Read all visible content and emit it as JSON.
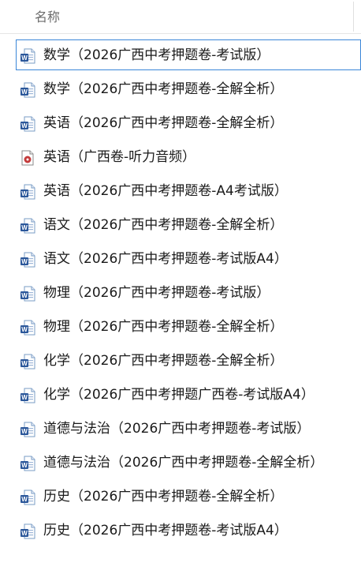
{
  "column_header": {
    "name_label": "名称"
  },
  "colors": {
    "selection_border": "#3a86d8",
    "word_icon_blue": "#2b579a",
    "audio_icon_red": "#c43b3b"
  },
  "files": [
    {
      "name": "数学（2026广西中考押题卷-考试版）",
      "icon": "word-document-icon",
      "selected": true
    },
    {
      "name": "数学（2026广西中考押题卷-全解全析）",
      "icon": "word-document-icon",
      "selected": false
    },
    {
      "name": "英语（2026广西中考押题卷-全解全析）",
      "icon": "word-document-icon",
      "selected": false
    },
    {
      "name": "英语（广西卷-听力音频）",
      "icon": "audio-file-icon",
      "selected": false
    },
    {
      "name": "英语（2026广西中考押题卷-A4考试版）",
      "icon": "word-document-icon",
      "selected": false
    },
    {
      "name": "语文（2026广西中考押题卷-全解全析）",
      "icon": "word-document-icon",
      "selected": false
    },
    {
      "name": "语文（2026广西中考押题卷-考试版A4）",
      "icon": "word-document-icon",
      "selected": false
    },
    {
      "name": "物理（2026广西中考押题卷-考试版）",
      "icon": "word-document-icon",
      "selected": false
    },
    {
      "name": "物理（2026广西中考押题卷-全解全析）",
      "icon": "word-document-icon",
      "selected": false
    },
    {
      "name": "化学（2026广西中考押题卷-全解全析）",
      "icon": "word-document-icon",
      "selected": false
    },
    {
      "name": "化学（2026广西中考押题广西卷-考试版A4）",
      "icon": "word-document-icon",
      "selected": false
    },
    {
      "name": "道德与法治（2026广西中考押题卷-考试版）",
      "icon": "word-document-icon",
      "selected": false
    },
    {
      "name": "道德与法治（2026广西中考押题卷-全解全析）",
      "icon": "word-document-icon",
      "selected": false
    },
    {
      "name": "历史（2026广西中考押题卷-全解全析）",
      "icon": "word-document-icon",
      "selected": false
    },
    {
      "name": "历史（2026广西中考押题卷-考试版A4）",
      "icon": "word-document-icon",
      "selected": false
    }
  ]
}
